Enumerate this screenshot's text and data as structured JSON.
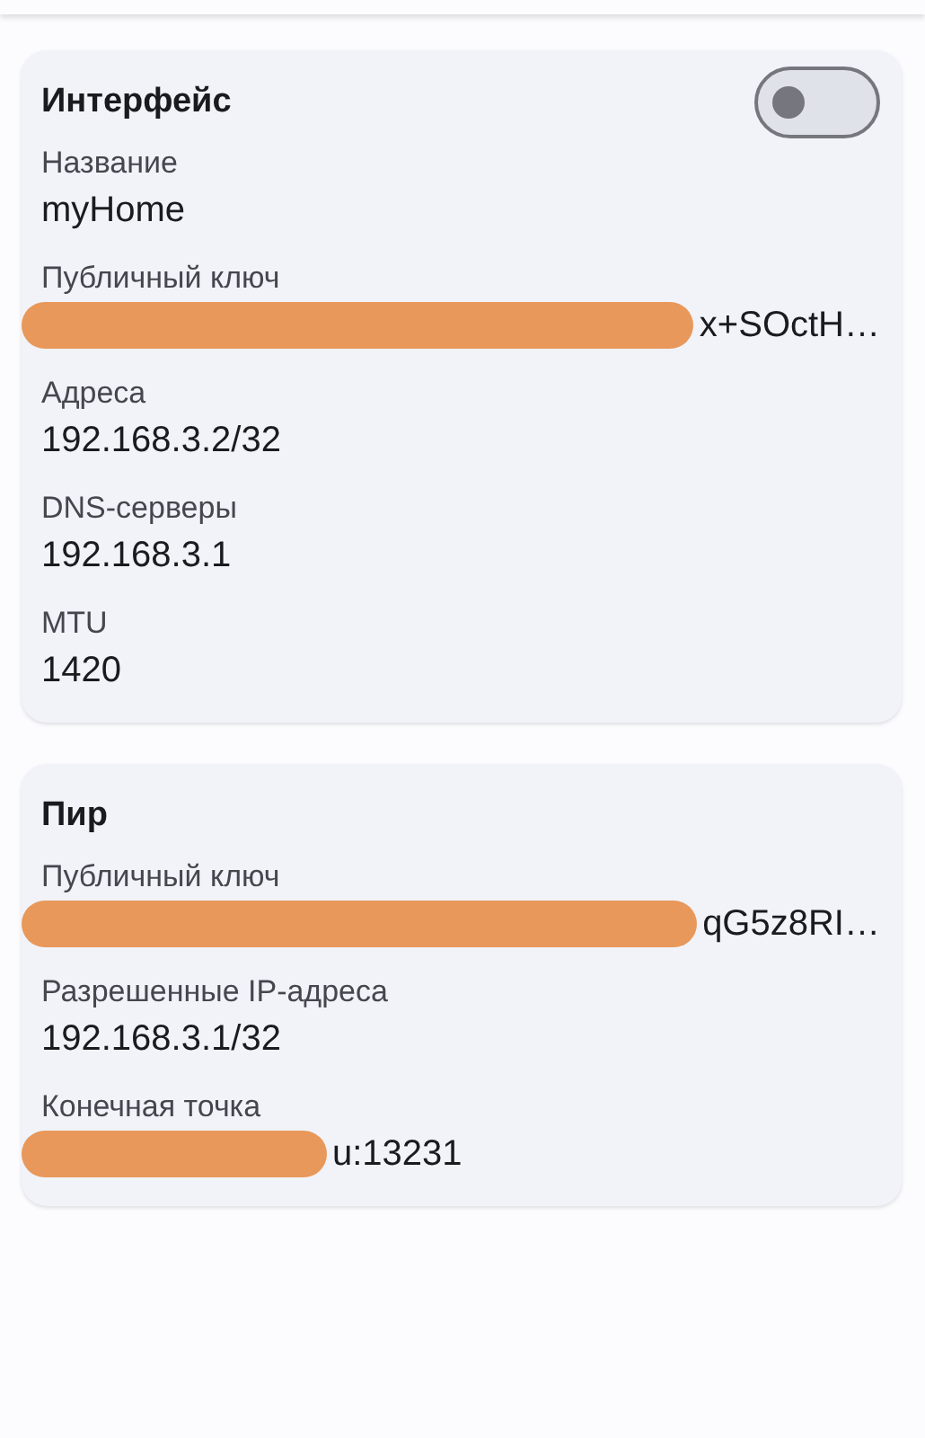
{
  "sections": [
    {
      "title": "Интерфейс",
      "toggle": {
        "on": false
      },
      "fields": [
        {
          "label": "Название",
          "value": "myHome",
          "kind": "plain"
        },
        {
          "label": "Публичный ключ",
          "value": "x+SOctH…",
          "kind": "hidden"
        },
        {
          "label": "Адреса",
          "value": "192.168.3.2/32",
          "kind": "plain"
        },
        {
          "label": "DNS-серверы",
          "value": "192.168.3.1",
          "kind": "plain"
        },
        {
          "label": "MTU",
          "value": "1420",
          "kind": "plain"
        }
      ]
    },
    {
      "title": "Пир",
      "fields": [
        {
          "label": "Публичный ключ",
          "value": "qG5z8RI…",
          "kind": "hidden"
        },
        {
          "label": "Разрешенные IP-адреса",
          "value": "192.168.3.1/32",
          "kind": "plain"
        },
        {
          "label": "Конечная точка",
          "value": "u:13231",
          "kind": "partial"
        }
      ]
    }
  ]
}
